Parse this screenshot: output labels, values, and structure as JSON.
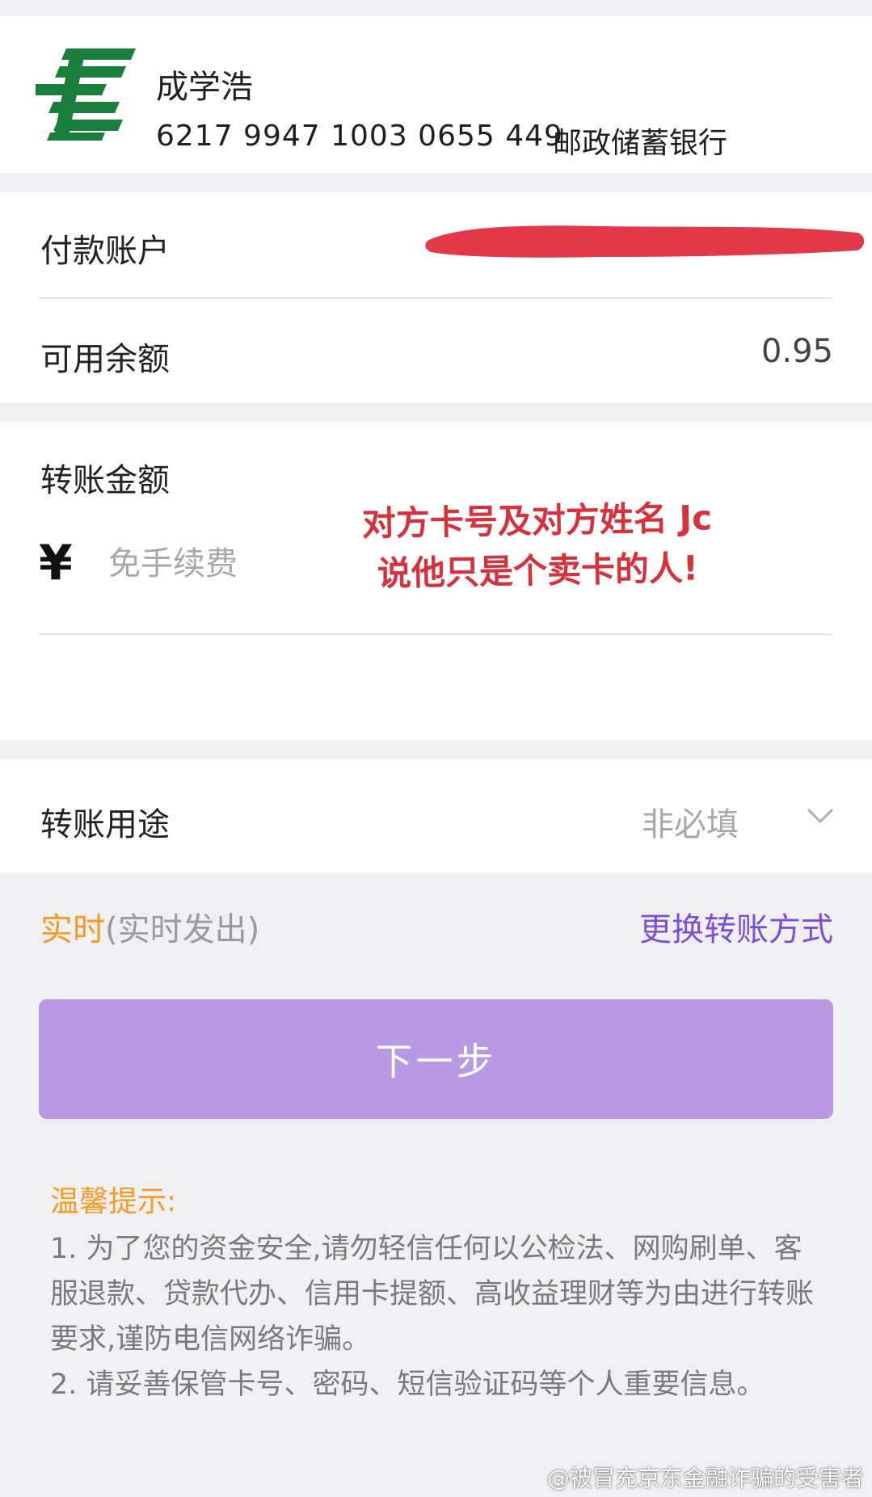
{
  "recipient": {
    "name": "成学浩",
    "card_number": "6217 9947 1003 0655 449",
    "bank_name": "邮政储蓄银行",
    "logo_icon": "china-post-bank-logo"
  },
  "payer": {
    "account_label": "付款账户",
    "account_value_redacted": true,
    "balance_label": "可用余额",
    "balance_value": "0.95"
  },
  "amount": {
    "label": "转账金额",
    "currency_symbol": "¥",
    "placeholder": "免手续费",
    "value": ""
  },
  "annotation": {
    "line1": "对方卡号及对方姓名 Jc",
    "line2": "说他只是个卖卡的人!"
  },
  "purpose": {
    "label": "转账用途",
    "value": "非必填",
    "icon": "chevron-down-icon"
  },
  "transfer_mode": {
    "label": "实时",
    "sub_label": "(实时发出)",
    "change_label": "更换转账方式"
  },
  "next_button": {
    "label": "下一步"
  },
  "tips": {
    "title": "温馨提示:",
    "item1": "1. 为了您的资金安全,请勿轻信任何以公检法、网购刷单、客服退款、贷款代办、信用卡提额、高收益理财等为由进行转账要求,谨防电信网络诈骗。",
    "item2": "2. 请妥善保管卡号、密码、短信验证码等个人重要信息。"
  },
  "watermark": "@被冒充京东金融诈骗的受害者",
  "colors": {
    "accent_orange": "#f59a23",
    "accent_purple": "#7a4fd8",
    "button_purple": "#b89ae4",
    "annotation_red": "#d8313e",
    "logo_green": "#1a7f3c"
  }
}
